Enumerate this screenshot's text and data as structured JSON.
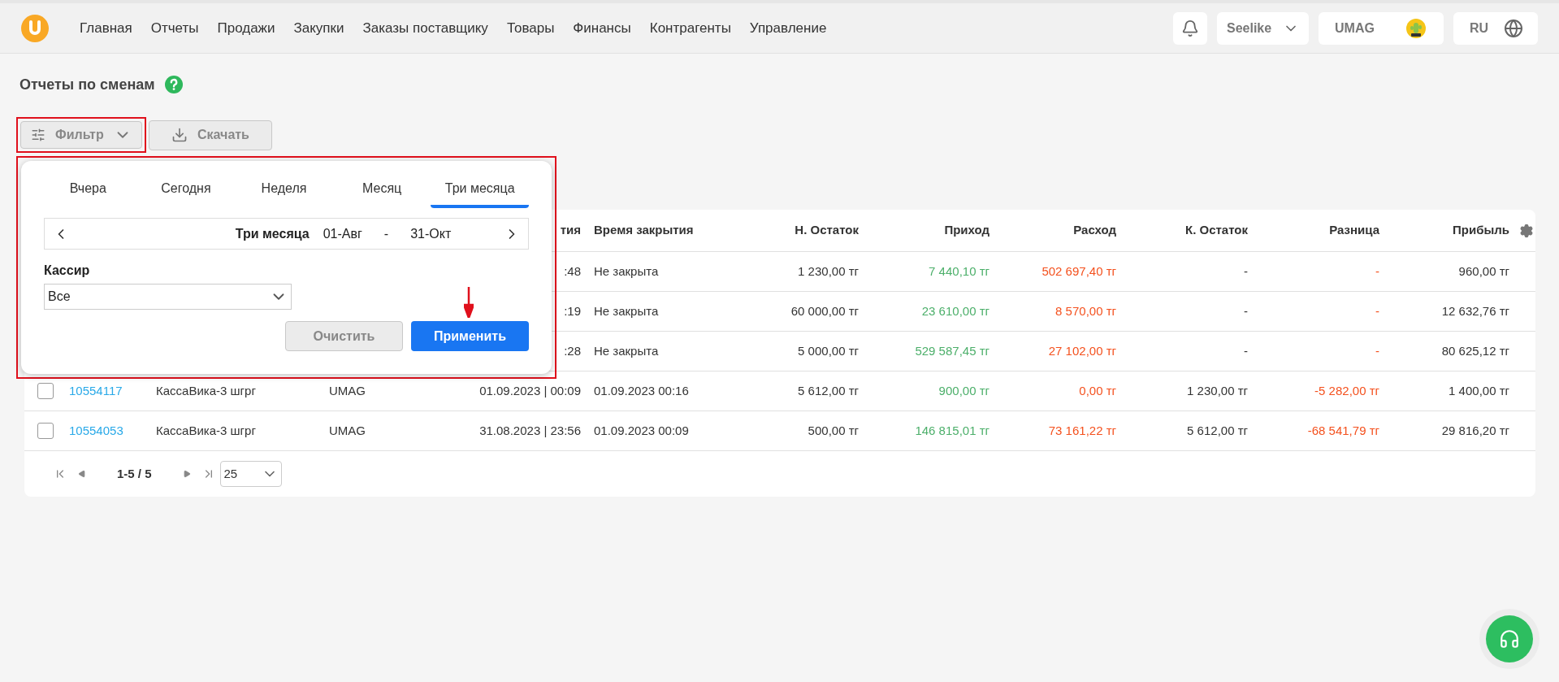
{
  "nav": {
    "items": [
      "Главная",
      "Отчеты",
      "Продажи",
      "Закупки",
      "Заказы поставщику",
      "Товары",
      "Финансы",
      "Контрагенты",
      "Управление"
    ],
    "store": "Seelike",
    "account": "UMAG",
    "language": "RU"
  },
  "page": {
    "title": "Отчеты по сменам",
    "filter_button": "Фильтр",
    "download_button": "Скачать"
  },
  "filter_popover": {
    "tabs": [
      {
        "label": "Вчера",
        "selected": false
      },
      {
        "label": "Сегодня",
        "selected": false
      },
      {
        "label": "Неделя",
        "selected": false
      },
      {
        "label": "Месяц",
        "selected": false
      },
      {
        "label": "Три месяца",
        "selected": true
      }
    ],
    "period": {
      "label": "Три месяца",
      "from": "01-Авг",
      "separator": "-",
      "to": "31-Окт"
    },
    "cashier": {
      "label": "Кассир",
      "value": "Все"
    },
    "clear_button": "Очистить",
    "apply_button": "Применить"
  },
  "table": {
    "columns": [
      "тия",
      "Время закрытия",
      "Н. Остаток",
      "Приход",
      "Расход",
      "К. Остаток",
      "Разница",
      "Прибыль"
    ],
    "rows": [
      {
        "open_time": ":48",
        "close_time": "Не закрыта",
        "start_balance": "1 230,00 тг",
        "income": "7 440,10 тг",
        "expense": "502 697,40 тг",
        "end_balance": "-",
        "difference": "-",
        "profit": "960,00 тг"
      },
      {
        "open_time": ":19",
        "close_time": "Не закрыта",
        "start_balance": "60 000,00 тг",
        "income": "23 610,00 тг",
        "expense": "8 570,00 тг",
        "end_balance": "-",
        "difference": "-",
        "profit": "12 632,76 тг"
      },
      {
        "open_time": ":28",
        "close_time": "Не закрыта",
        "start_balance": "5 000,00 тг",
        "income": "529 587,45 тг",
        "expense": "27 102,00 тг",
        "end_balance": "-",
        "difference": "-",
        "profit": "80 625,12 тг"
      },
      {
        "checked": false,
        "number": "10554117",
        "cashbox": "КассаВика-3 шгрг",
        "cashier": "UMAG",
        "open_time": "01.09.2023 | 00:09",
        "close_time": "01.09.2023 00:16",
        "start_balance": "5 612,00 тг",
        "income": "900,00 тг",
        "expense": "0,00 тг",
        "end_balance": "1 230,00 тг",
        "difference": "-5 282,00 тг",
        "profit": "1 400,00 тг"
      },
      {
        "checked": false,
        "number": "10554053",
        "cashbox": "КассаВика-3 шгрг",
        "cashier": "UMAG",
        "open_time": "31.08.2023 | 23:56",
        "close_time": "01.09.2023 00:09",
        "start_balance": "500,00 тг",
        "income": "146 815,01 тг",
        "expense": "73 161,22 тг",
        "end_balance": "5 612,00 тг",
        "difference": "-68 541,79 тг",
        "profit": "29 816,20 тг"
      }
    ]
  },
  "pagination": {
    "range": "1-5 / 5",
    "page_size": "25"
  }
}
